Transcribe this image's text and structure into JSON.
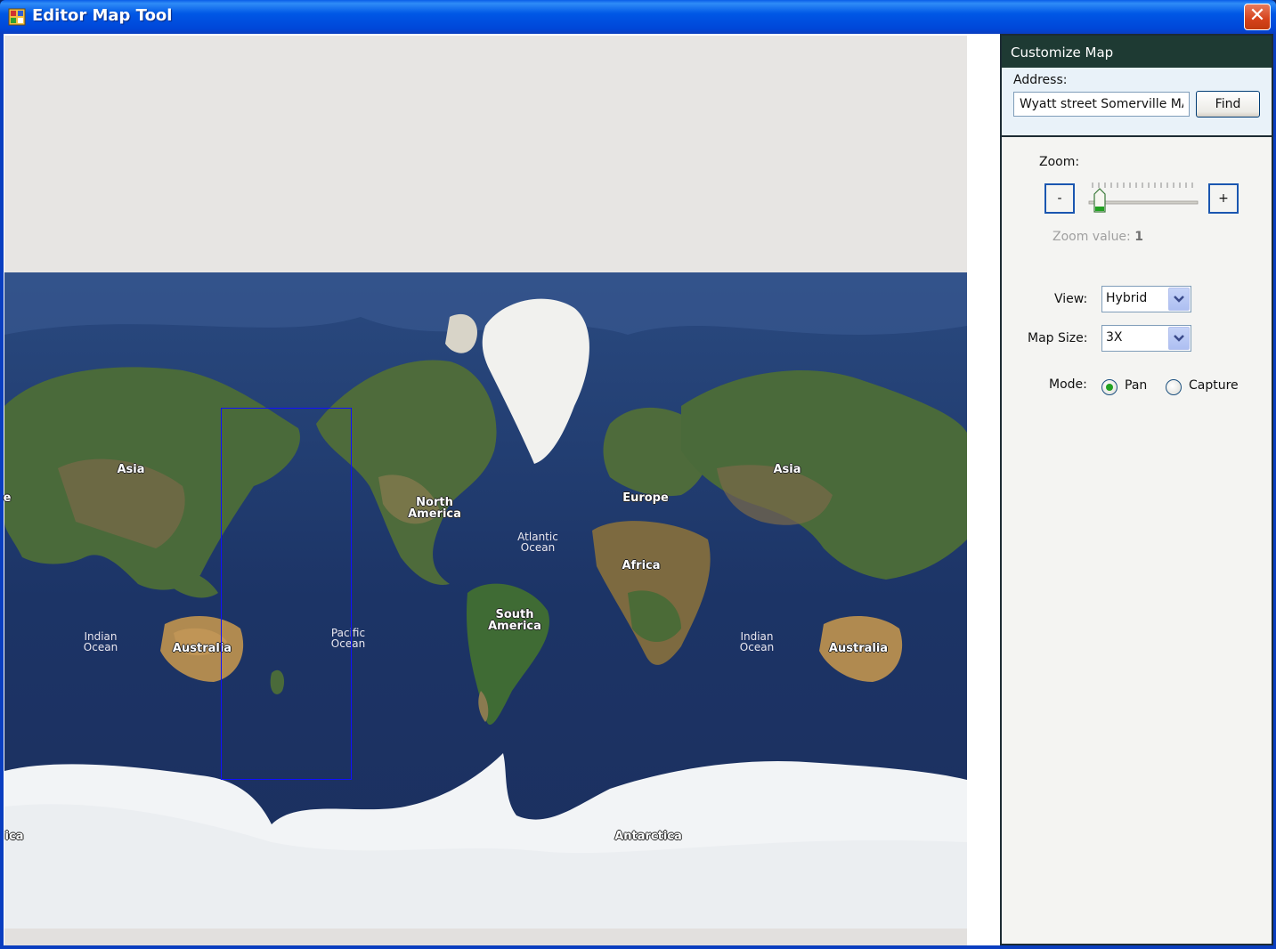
{
  "window": {
    "title": "Editor Map Tool",
    "close_glyph": "✕"
  },
  "map": {
    "continent_labels": [
      {
        "text": "Asia"
      },
      {
        "text": "North\nAmerica"
      },
      {
        "text": "Europe"
      },
      {
        "text": "Asia"
      },
      {
        "text": "Africa"
      },
      {
        "text": "South\nAmerica"
      },
      {
        "text": "Australia"
      },
      {
        "text": "Australia"
      },
      {
        "text": "Antarctica"
      },
      {
        "text": "e"
      },
      {
        "text": "ica"
      }
    ],
    "ocean_labels": [
      {
        "text": "Atlantic\nOcean"
      },
      {
        "text": "Indian\nOcean"
      },
      {
        "text": "Pacific\nOcean"
      },
      {
        "text": "Indian\nOcean"
      }
    ]
  },
  "panel": {
    "header": "Customize Map",
    "address_label": "Address:",
    "address_value": "Wyatt street Somerville MA",
    "find_label": "Find",
    "zoom_label": "Zoom:",
    "zoom_minus": "-",
    "zoom_plus": "+",
    "zoom_value_label": "Zoom value:",
    "zoom_value": "1",
    "view_label": "View:",
    "view_value": "Hybrid",
    "map_size_label": "Map Size:",
    "map_size_value": "3X",
    "mode_label": "Mode:",
    "mode_options": [
      {
        "label": "Pan",
        "checked": true
      },
      {
        "label": "Capture",
        "checked": false
      }
    ]
  }
}
